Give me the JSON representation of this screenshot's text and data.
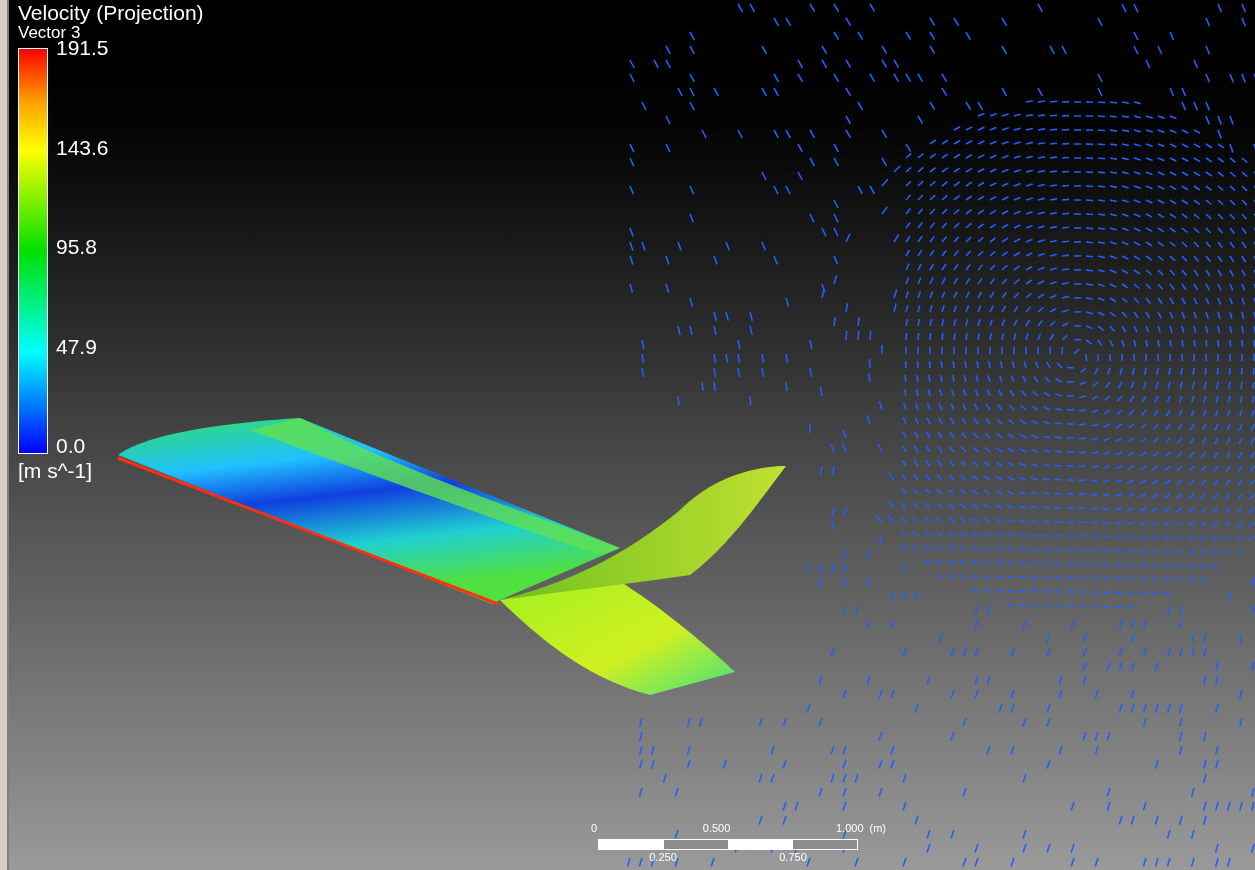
{
  "legend": {
    "title": "Velocity (Projection)",
    "subtitle": "Vector 3",
    "ticks": [
      "191.5",
      "143.6",
      "95.8",
      "47.9",
      "0.0"
    ],
    "unit": "[m s^-1]"
  },
  "scale_bar": {
    "top_labels": [
      "0",
      "0.500",
      "1.000"
    ],
    "unit": "(m)",
    "bottom_labels": [
      "0.250",
      "0.750"
    ]
  }
}
